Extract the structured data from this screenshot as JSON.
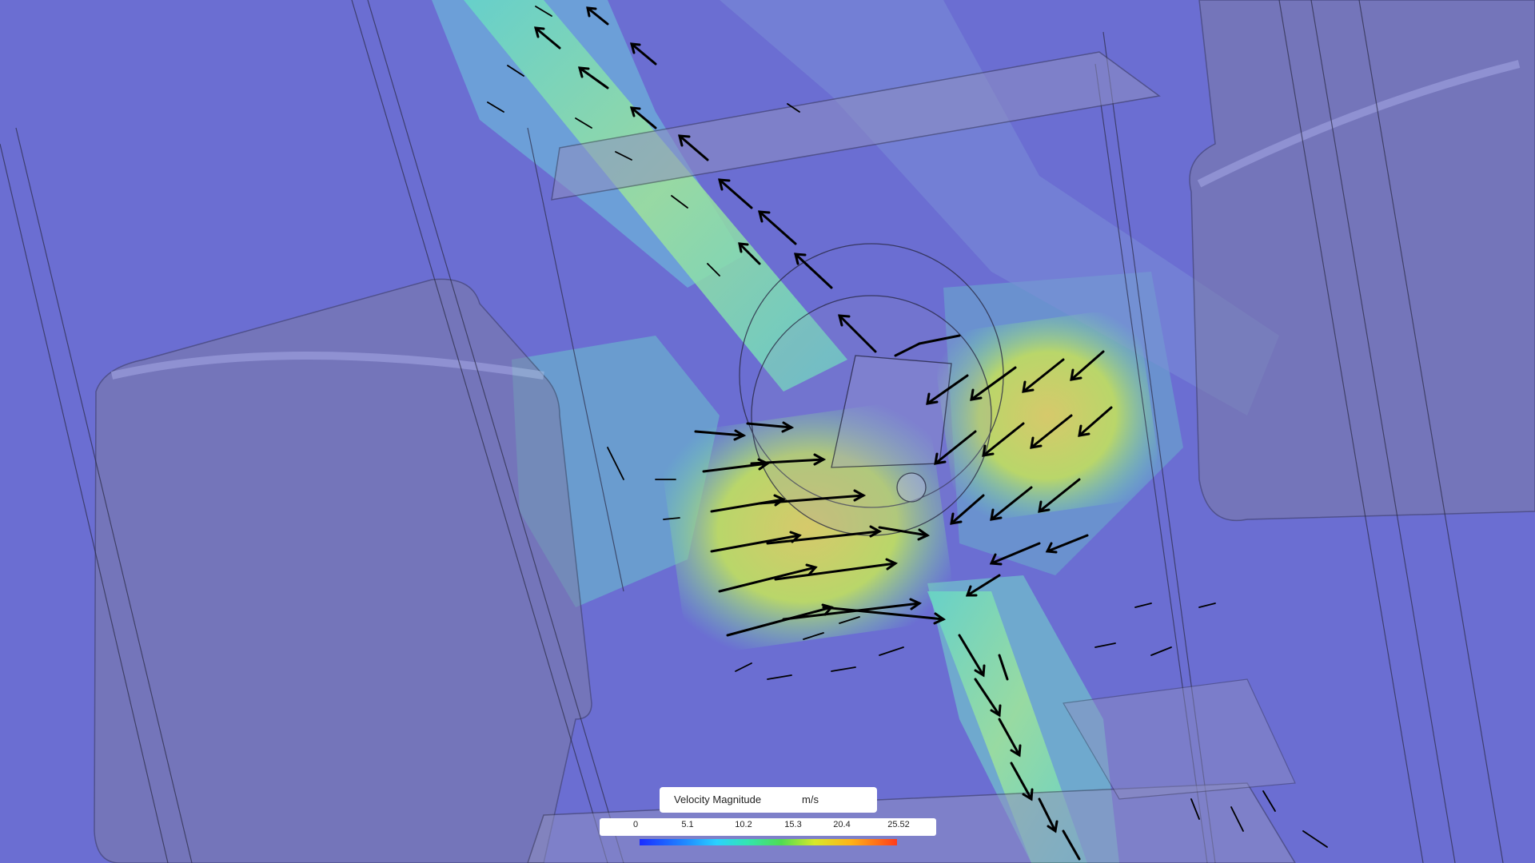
{
  "app": {
    "view": "3D CFD velocity field"
  },
  "legend": {
    "title": "Velocity Magnitude",
    "unit": "m/s",
    "ticks": [
      "0",
      "5.1",
      "10.2",
      "15.3",
      "20.4",
      "25.52"
    ],
    "colors": {
      "min": "#1a2cff",
      "mid": "#4fdc52",
      "max": "#ff3b1a"
    }
  }
}
